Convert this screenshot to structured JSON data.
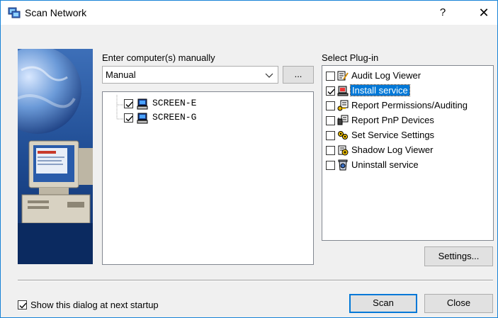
{
  "window": {
    "title": "Scan Network",
    "help_label": "?",
    "close_label": "✕"
  },
  "manual": {
    "label": "Enter computer(s) manually",
    "combo_value": "Manual",
    "browse_label": "..."
  },
  "computers": [
    {
      "name": "SCREEN-E",
      "checked": true
    },
    {
      "name": "SCREEN-G",
      "checked": true
    }
  ],
  "plugins": {
    "label": "Select Plug-in",
    "items": [
      {
        "label": "Audit Log Viewer",
        "checked": false,
        "icon": "audit-log-icon"
      },
      {
        "label": "Install service",
        "checked": true,
        "selected": true,
        "icon": "install-service-icon"
      },
      {
        "label": "Report Permissions/Auditing",
        "checked": false,
        "icon": "report-permissions-icon"
      },
      {
        "label": "Report PnP Devices",
        "checked": false,
        "icon": "report-pnp-icon"
      },
      {
        "label": "Set Service Settings",
        "checked": false,
        "icon": "service-settings-icon"
      },
      {
        "label": "Shadow Log Viewer",
        "checked": false,
        "icon": "shadow-log-icon"
      },
      {
        "label": "Uninstall service",
        "checked": false,
        "icon": "uninstall-service-icon"
      }
    ]
  },
  "buttons": {
    "settings": "Settings...",
    "scan": "Scan",
    "close": "Close"
  },
  "startup": {
    "label": "Show this dialog at next startup",
    "checked": true
  }
}
